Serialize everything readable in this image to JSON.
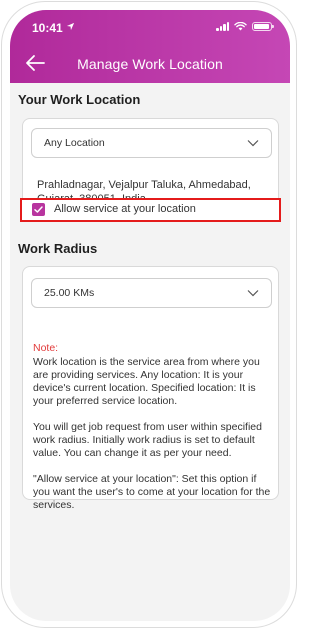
{
  "status_bar": {
    "time": "10:41"
  },
  "header": {
    "title": "Manage Work Location"
  },
  "work_location": {
    "section_title": "Your Work Location",
    "dropdown_value": "Any Location",
    "address": "Prahladnagar, Vejalpur Taluka, Ahmedabad, Gujarat, 380051, India",
    "allow_service_label": "Allow service at your location",
    "allow_service_checked": true
  },
  "work_radius": {
    "section_title": "Work Radius",
    "dropdown_value": "25.00 KMs",
    "note_label": "Note:",
    "note_text": "Work location is the service area from where you are providing services. Any location: It is your device's current location. Specified location: It is your preferred service location.\n\nYou will get job request from user within specified work radius. Initially work radius is set to default value. You can change it as per your need.\n\n\"Allow service at your location\": Set this option if you want the user's to come at your location for the services."
  },
  "colors": {
    "header_start": "#b0299a",
    "header_end": "#c547b5",
    "checkbox": "#b8359f",
    "highlight_border": "#e41b1b",
    "note_label": "#e23b3b"
  },
  "icons": [
    "location-arrow-icon",
    "signal-icon",
    "wifi-icon",
    "battery-icon",
    "back-arrow-icon",
    "chevron-down-icon",
    "checkmark-icon"
  ]
}
